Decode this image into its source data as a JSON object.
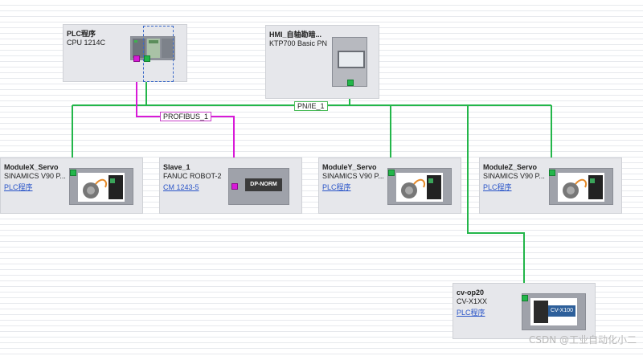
{
  "devices": {
    "plc": {
      "title": "PLC程序",
      "type": "CPU 1214C"
    },
    "hmi": {
      "title": "HMI_自轴勘暗...",
      "type": "KTP700 Basic PN"
    },
    "modx": {
      "title": "ModuleX_Servo",
      "type": "SINAMICS V90 P...",
      "link": "PLC程序"
    },
    "slave": {
      "title": "Slave_1",
      "type": "FANUC ROBOT-2",
      "link": "CM 1243-5",
      "image_text": "DP-NORM"
    },
    "mody": {
      "title": "ModuleY_Servo",
      "type": "SINAMICS V90 P...",
      "link": "PLC程序"
    },
    "modz": {
      "title": "ModuleZ_Servo",
      "type": "SINAMICS V90 P...",
      "link": "PLC程序"
    },
    "cvop": {
      "title": "cv-op20",
      "type": "CV-X1XX",
      "link": "PLC程序",
      "image_text": "CV-X100"
    }
  },
  "networks": {
    "profibus": "PROFIBUS_1",
    "pnie": "PN/IE_1"
  },
  "colors": {
    "profinet": "#23b64a",
    "profibus": "#d81ad8"
  },
  "watermark": "CSDN @工业自动化小二"
}
